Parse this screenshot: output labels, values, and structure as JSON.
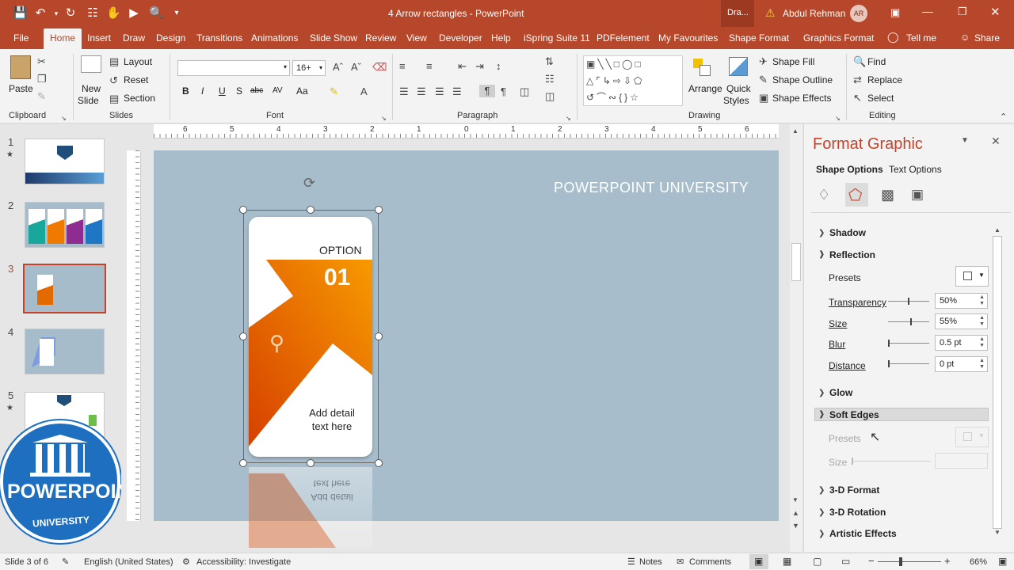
{
  "titlebar": {
    "title": "4 Arrow rectangles  -  PowerPoint",
    "search_hint": "Dra...",
    "user_name": "Abdul Rehman",
    "user_initials": "AR"
  },
  "tabs": [
    "File",
    "Home",
    "Insert",
    "Draw",
    "Design",
    "Transitions",
    "Animations",
    "Slide Show",
    "Review",
    "View",
    "Developer",
    "Help",
    "iSpring Suite 11",
    "PDFelement",
    "My Favourites",
    "Shape Format",
    "Graphics Format",
    "Tell me",
    "Share"
  ],
  "ribbon": {
    "clipboard": {
      "label": "Clipboard",
      "paste": "Paste"
    },
    "slides": {
      "label": "Slides",
      "new_slide": "New",
      "new_slide2": "Slide",
      "layout": "Layout",
      "reset": "Reset",
      "section": "Section"
    },
    "font": {
      "label": "Font",
      "font_size": "16+",
      "bold": "B",
      "italic": "I",
      "underline": "U",
      "shadow": "S",
      "strike": "abc",
      "spacing": "AV",
      "case": "Aa"
    },
    "paragraph": {
      "label": "Paragraph"
    },
    "drawing": {
      "label": "Drawing",
      "arrange": "Arrange",
      "quick_styles": "Quick",
      "quick_styles2": "Styles",
      "shape_fill": "Shape Fill",
      "shape_outline": "Shape Outline",
      "shape_effects": "Shape Effects"
    },
    "editing": {
      "label": "Editing",
      "find": "Find",
      "replace": "Replace",
      "select": "Select"
    }
  },
  "ruler_numbers": [
    "6",
    "5",
    "4",
    "3",
    "2",
    "1",
    "0",
    "1",
    "2",
    "3",
    "4",
    "5",
    "6"
  ],
  "thumbnails": [
    {
      "num": "1",
      "star": "★"
    },
    {
      "num": "2",
      "star": ""
    },
    {
      "num": "3",
      "star": ""
    },
    {
      "num": "4",
      "star": ""
    },
    {
      "num": "5",
      "star": "★"
    }
  ],
  "slide": {
    "brand": "POWERPOINT UNIVERSITY",
    "option": "OPTION",
    "number": "01",
    "detail1": "Add detail",
    "detail2": "text here"
  },
  "logo": {
    "line1": "POWERPOINT",
    "line2": "UNIVERSITY"
  },
  "format_pane": {
    "title": "Format Graphic",
    "tab_shape": "Shape Options",
    "tab_text": "Text Options",
    "shadow": "Shadow",
    "reflection": "Reflection",
    "presets": "Presets",
    "transparency": "Transparency",
    "transparency_val": "50%",
    "size": "Size",
    "size_val": "55%",
    "blur": "Blur",
    "blur_val": "0.5 pt",
    "distance": "Distance",
    "distance_val": "0 pt",
    "glow": "Glow",
    "soft_edges": "Soft Edges",
    "presets2": "Presets",
    "size2": "Size",
    "format3d": "3-D Format",
    "rotation3d": "3-D Rotation",
    "artistic": "Artistic Effects"
  },
  "status": {
    "slide_info": "Slide 3 of 6",
    "language": "English (United States)",
    "accessibility": "Accessibility: Investigate",
    "notes": "Notes",
    "comments": "Comments",
    "zoom": "66%"
  },
  "colors": {
    "accent": "#b7472a",
    "orange": "#f07a00",
    "slide_bg": "#a7bdcb"
  }
}
